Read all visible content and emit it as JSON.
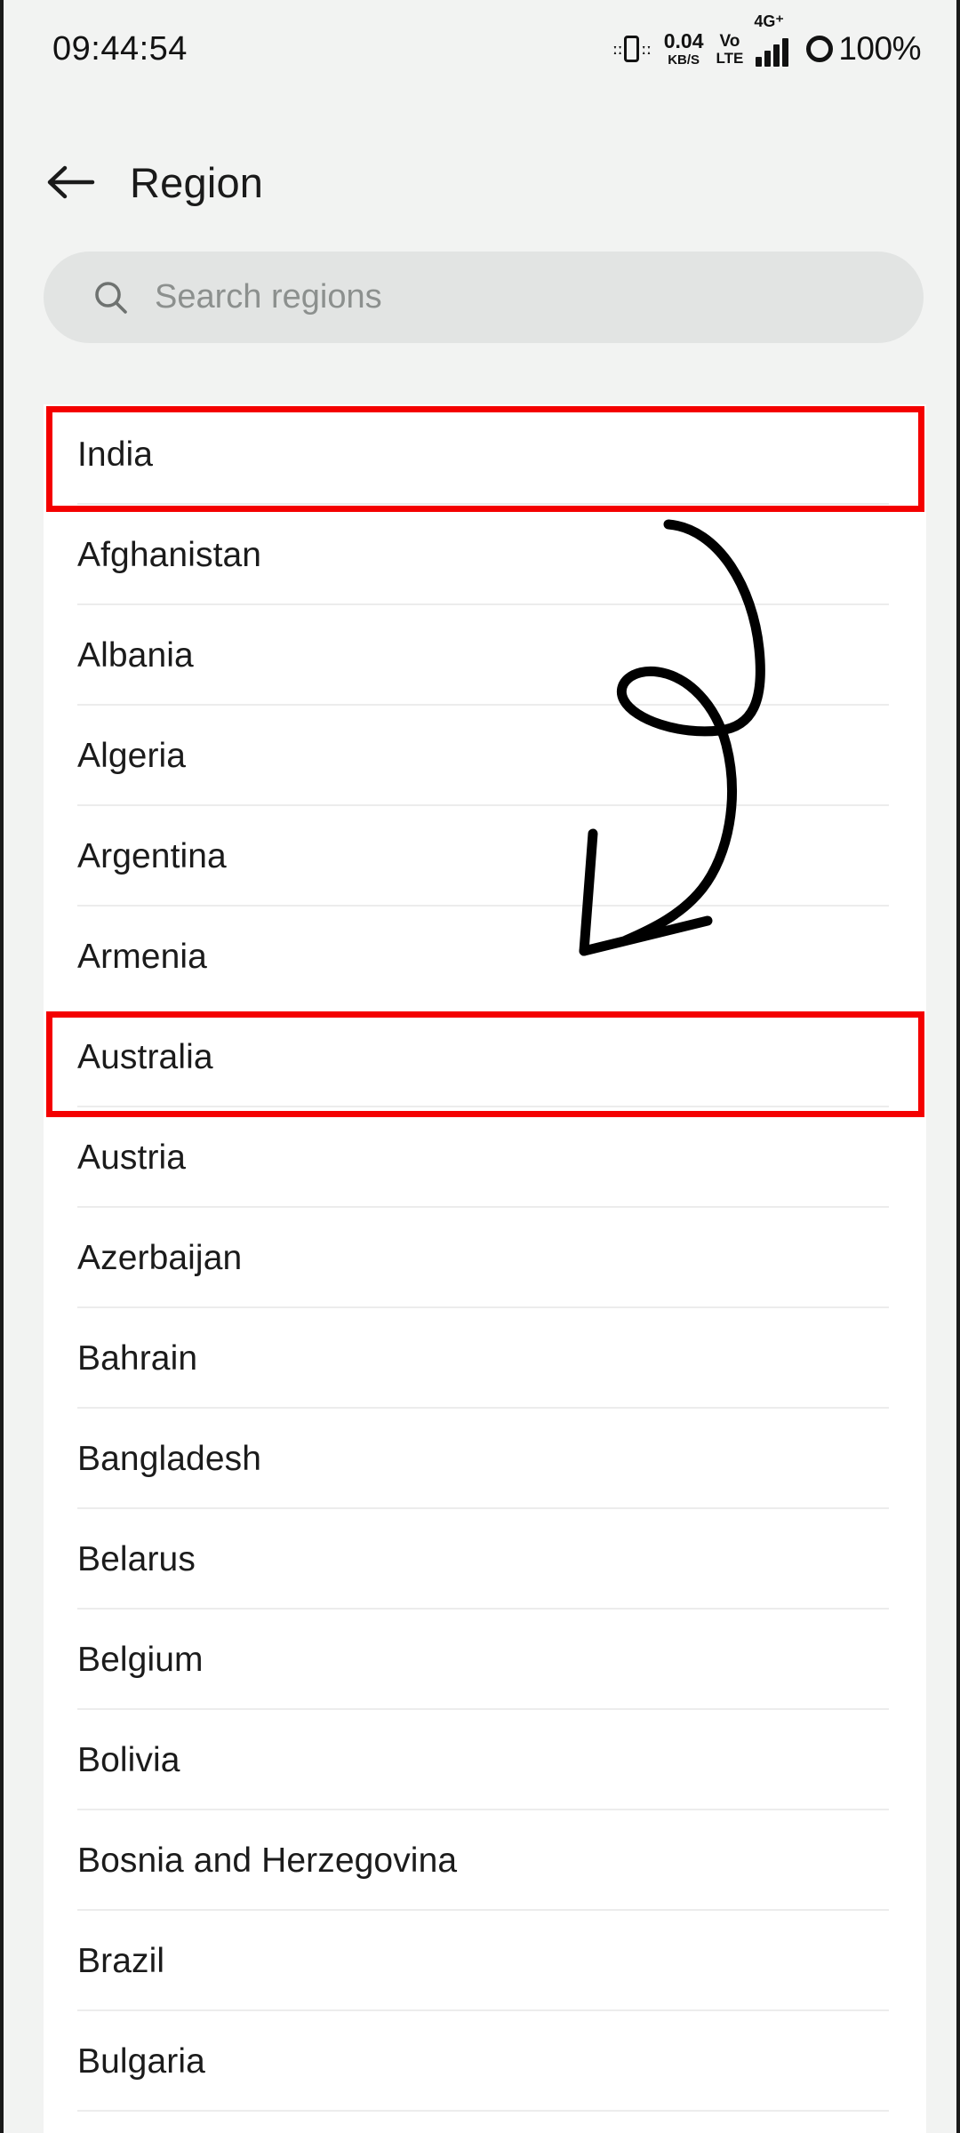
{
  "status_bar": {
    "clock": "09:44:54",
    "vibrate_icon": "vibrate-icon",
    "net_speed_value": "0.04",
    "net_speed_unit": "KB/S",
    "volte_top": "Vo",
    "volte_bottom": "LTE",
    "network_type": "4G⁺",
    "signal_icon": "signal-bars-icon",
    "battery_icon": "battery-ring-icon",
    "battery_percent": "100%"
  },
  "header": {
    "back_icon": "back-arrow-icon",
    "title": "Region"
  },
  "search": {
    "icon": "search-icon",
    "placeholder": "Search regions",
    "value": ""
  },
  "region_list": {
    "items": [
      {
        "label": "India"
      },
      {
        "label": "Afghanistan"
      },
      {
        "label": "Albania"
      },
      {
        "label": "Algeria"
      },
      {
        "label": "Argentina"
      },
      {
        "label": "Armenia"
      },
      {
        "label": "Australia"
      },
      {
        "label": "Austria"
      },
      {
        "label": "Azerbaijan"
      },
      {
        "label": "Bahrain"
      },
      {
        "label": "Bangladesh"
      },
      {
        "label": "Belarus"
      },
      {
        "label": "Belgium"
      },
      {
        "label": "Bolivia"
      },
      {
        "label": "Bosnia and Herzegovina"
      },
      {
        "label": "Brazil"
      },
      {
        "label": "Bulgaria"
      }
    ]
  },
  "annotations": {
    "highlight_color": "#f40000",
    "highlighted_items": [
      "India",
      "Australia"
    ],
    "arrow_icon": "curved-arrow-annotation",
    "arrow_color": "#000000"
  },
  "colors": {
    "page_background": "#f2f3f2",
    "card_background": "#ffffff",
    "search_background": "#e2e4e3",
    "text_primary": "#1b1b1b",
    "text_placeholder": "#8c908e",
    "divider": "#ececec"
  }
}
